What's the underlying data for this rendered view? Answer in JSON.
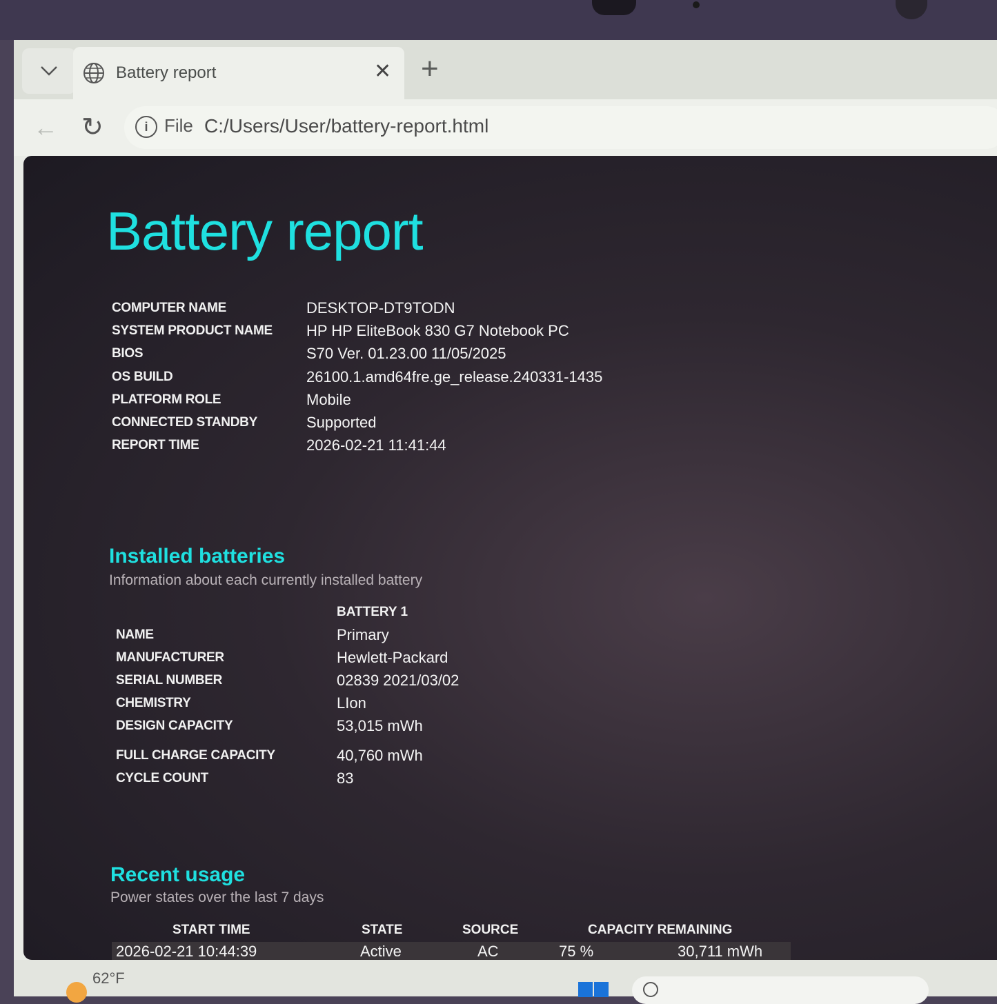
{
  "browser": {
    "tab_title": "Battery report",
    "url_scheme": "File",
    "url": "C:/Users/User/battery-report.html"
  },
  "report": {
    "title": "Battery report",
    "system_info": [
      {
        "key": "COMPUTER NAME",
        "value": "DESKTOP-DT9TODN"
      },
      {
        "key": "SYSTEM PRODUCT NAME",
        "value": "HP HP EliteBook 830 G7 Notebook PC"
      },
      {
        "key": "BIOS",
        "value": "S70 Ver. 01.23.00 11/05/2025"
      },
      {
        "key": "OS BUILD",
        "value": "26100.1.amd64fre.ge_release.240331-1435"
      },
      {
        "key": "PLATFORM ROLE",
        "value": "Mobile"
      },
      {
        "key": "CONNECTED STANDBY",
        "value": "Supported"
      },
      {
        "key": "REPORT TIME",
        "value": "2026-02-21  11:41:44"
      }
    ],
    "installed_batteries": {
      "title": "Installed batteries",
      "subtitle": "Information about each currently installed battery",
      "column_header": "BATTERY 1",
      "rows": [
        {
          "key": "NAME",
          "value": "Primary"
        },
        {
          "key": "MANUFACTURER",
          "value": "Hewlett-Packard"
        },
        {
          "key": "SERIAL NUMBER",
          "value": "02839 2021/03/02"
        },
        {
          "key": "CHEMISTRY",
          "value": "LIon"
        },
        {
          "key": "DESIGN CAPACITY",
          "value": "53,015 mWh"
        },
        {
          "key": "FULL CHARGE CAPACITY",
          "value": "40,760 mWh"
        },
        {
          "key": "CYCLE COUNT",
          "value": "83"
        }
      ]
    },
    "recent_usage": {
      "title": "Recent usage",
      "subtitle": "Power states over the last 7 days",
      "headers": [
        "START TIME",
        "STATE",
        "SOURCE",
        "CAPACITY REMAINING"
      ],
      "rows": [
        {
          "start_time": "2026-02-21  10:44:39",
          "state": "Active",
          "source": "AC",
          "percent": "75 %",
          "mwh": "30,711 mWh"
        }
      ]
    }
  },
  "taskbar": {
    "weather": "62°F"
  },
  "icons": [
    "chevron-down-icon",
    "globe-icon",
    "close-icon",
    "plus-icon",
    "back-arrow-icon",
    "reload-icon",
    "info-icon",
    "weather-icon",
    "windows-logo-icon",
    "search-icon"
  ],
  "colors": {
    "accent": "#1fe0e0",
    "page_bg": "#2e2730"
  }
}
